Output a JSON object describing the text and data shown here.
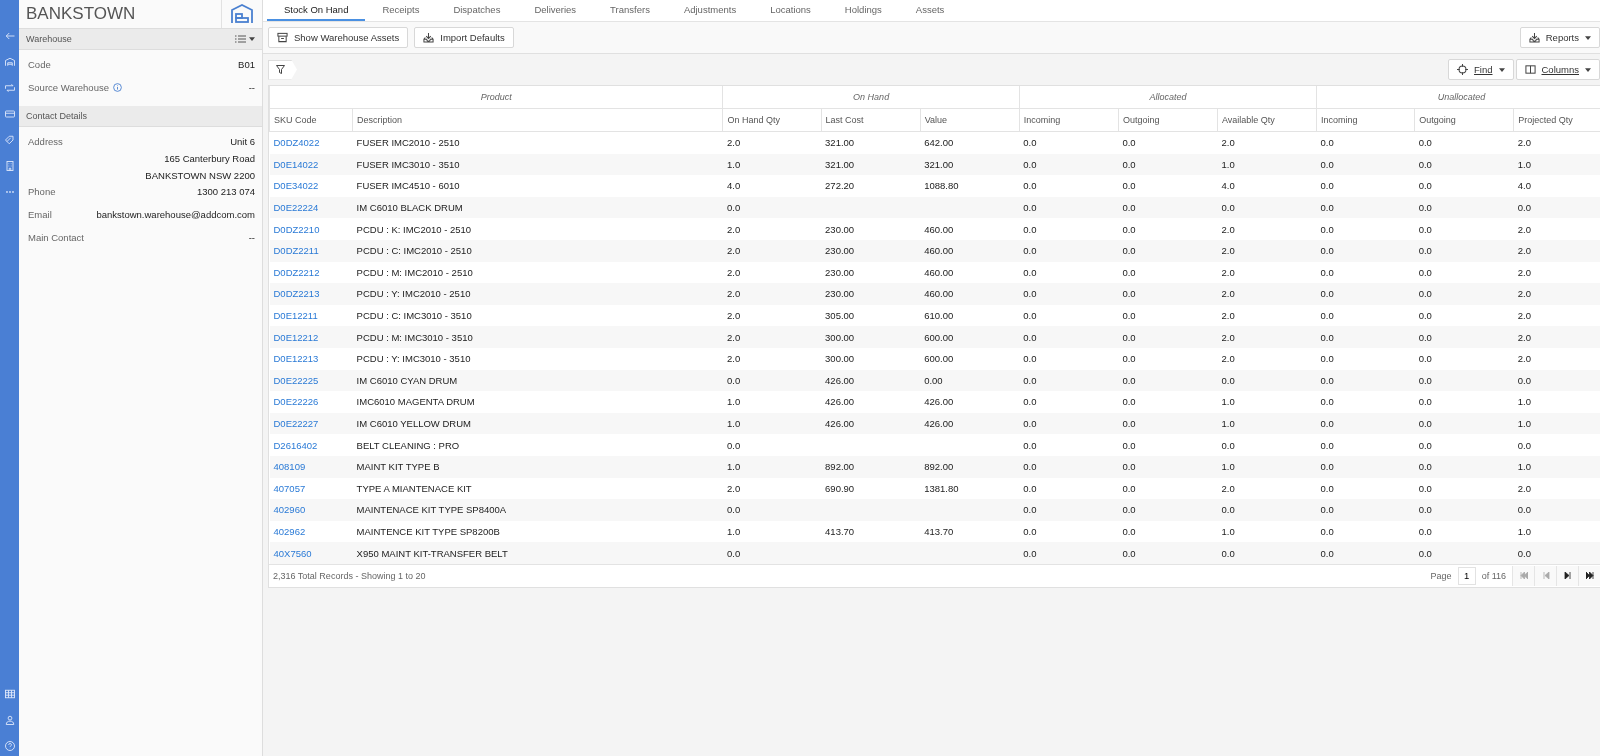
{
  "rail": {
    "items": [
      {
        "kind": "back"
      },
      {
        "kind": "warehouse"
      },
      {
        "kind": "transfer"
      },
      {
        "kind": "card"
      },
      {
        "kind": "tags"
      },
      {
        "kind": "building"
      },
      {
        "kind": "more"
      }
    ],
    "bottom_items": [
      {
        "kind": "grid"
      },
      {
        "kind": "user"
      },
      {
        "kind": "help"
      }
    ]
  },
  "sidebar": {
    "title": "BANKSTOWN",
    "sections": [
      {
        "title": "Warehouse",
        "menu": true,
        "fields": [
          {
            "label": "Code",
            "value": [
              "B01"
            ]
          },
          {
            "label": "Source Warehouse",
            "info": true,
            "value": [
              "--"
            ]
          }
        ]
      },
      {
        "title": "Contact Details",
        "menu": false,
        "fields": [
          {
            "label": "Address",
            "value": [
              "Unit 6",
              "165 Canterbury Road",
              "BANKSTOWN NSW 2200"
            ]
          },
          {
            "label": "Phone",
            "value": [
              "1300 213 074"
            ]
          },
          {
            "label": "Email",
            "value": [
              "bankstown.warehouse@addcom.com"
            ]
          },
          {
            "label": "Main Contact",
            "value": [
              "--"
            ]
          }
        ]
      }
    ]
  },
  "tabs": [
    {
      "label": "Stock On Hand",
      "selected": true
    },
    {
      "label": "Receipts",
      "selected": false
    },
    {
      "label": "Dispatches",
      "selected": false
    },
    {
      "label": "Deliveries",
      "selected": false
    },
    {
      "label": "Transfers",
      "selected": false
    },
    {
      "label": "Adjustments",
      "selected": false
    },
    {
      "label": "Locations",
      "selected": false
    },
    {
      "label": "Holdings",
      "selected": false
    },
    {
      "label": "Assets",
      "selected": false
    }
  ],
  "toolbar": {
    "buttons": [
      {
        "label": "Show Warehouse Assets",
        "kind": "archive"
      },
      {
        "label": "Import Defaults",
        "kind": "import"
      }
    ],
    "reports": "Reports"
  },
  "filter_bar": {
    "find": "Find",
    "columns": "Columns"
  },
  "table": {
    "groups": [
      "Product",
      "On Hand",
      "Allocated",
      "Unallocated"
    ],
    "columns": [
      "SKU Code",
      "Description",
      "On Hand Qty",
      "Last Cost",
      "Value",
      "Incoming",
      "Outgoing",
      "Available Qty",
      "Incoming",
      "Outgoing",
      "Projected Qty"
    ],
    "rows": [
      [
        "D0DZ4022",
        "FUSER IMC2010 - 2510",
        "2.0",
        "321.00",
        "642.00",
        "0.0",
        "0.0",
        "2.0",
        "0.0",
        "0.0",
        "2.0"
      ],
      [
        "D0E14022",
        "FUSER IMC3010 - 3510",
        "1.0",
        "321.00",
        "321.00",
        "0.0",
        "0.0",
        "1.0",
        "0.0",
        "0.0",
        "1.0"
      ],
      [
        "D0E34022",
        "FUSER IMC4510 - 6010",
        "4.0",
        "272.20",
        "1088.80",
        "0.0",
        "0.0",
        "4.0",
        "0.0",
        "0.0",
        "4.0"
      ],
      [
        "D0E22224",
        "IM C6010 BLACK DRUM",
        "0.0",
        null,
        null,
        "0.0",
        "0.0",
        "0.0",
        "0.0",
        "0.0",
        "0.0"
      ],
      [
        "D0DZ2210",
        "PCDU : K: IMC2010 - 2510",
        "2.0",
        "230.00",
        "460.00",
        "0.0",
        "0.0",
        "2.0",
        "0.0",
        "0.0",
        "2.0"
      ],
      [
        "D0DZ2211",
        "PCDU : C: IMC2010 - 2510",
        "2.0",
        "230.00",
        "460.00",
        "0.0",
        "0.0",
        "2.0",
        "0.0",
        "0.0",
        "2.0"
      ],
      [
        "D0DZ2212",
        "PCDU : M: IMC2010 - 2510",
        "2.0",
        "230.00",
        "460.00",
        "0.0",
        "0.0",
        "2.0",
        "0.0",
        "0.0",
        "2.0"
      ],
      [
        "D0DZ2213",
        "PCDU : Y: IMC2010 - 2510",
        "2.0",
        "230.00",
        "460.00",
        "0.0",
        "0.0",
        "2.0",
        "0.0",
        "0.0",
        "2.0"
      ],
      [
        "D0E12211",
        "PCDU : C: IMC3010 - 3510",
        "2.0",
        "305.00",
        "610.00",
        "0.0",
        "0.0",
        "2.0",
        "0.0",
        "0.0",
        "2.0"
      ],
      [
        "D0E12212",
        "PCDU : M: IMC3010 - 3510",
        "2.0",
        "300.00",
        "600.00",
        "0.0",
        "0.0",
        "2.0",
        "0.0",
        "0.0",
        "2.0"
      ],
      [
        "D0E12213",
        "PCDU : Y: IMC3010 - 3510",
        "2.0",
        "300.00",
        "600.00",
        "0.0",
        "0.0",
        "2.0",
        "0.0",
        "0.0",
        "2.0"
      ],
      [
        "D0E22225",
        "IM C6010 CYAN DRUM",
        "0.0",
        "426.00",
        "0.00",
        "0.0",
        "0.0",
        "0.0",
        "0.0",
        "0.0",
        "0.0"
      ],
      [
        "D0E22226",
        "IMC6010 MAGENTA DRUM",
        "1.0",
        "426.00",
        "426.00",
        "0.0",
        "0.0",
        "1.0",
        "0.0",
        "0.0",
        "1.0"
      ],
      [
        "D0E22227",
        "IM C6010 YELLOW DRUM",
        "1.0",
        "426.00",
        "426.00",
        "0.0",
        "0.0",
        "1.0",
        "0.0",
        "0.0",
        "1.0"
      ],
      [
        "D2616402",
        "BELT CLEANING : PRO",
        "0.0",
        null,
        null,
        "0.0",
        "0.0",
        "0.0",
        "0.0",
        "0.0",
        "0.0"
      ],
      [
        "408109",
        "MAINT KIT TYPE B",
        "1.0",
        "892.00",
        "892.00",
        "0.0",
        "0.0",
        "1.0",
        "0.0",
        "0.0",
        "1.0"
      ],
      [
        "407057",
        "TYPE A MIANTENACE KIT",
        "2.0",
        "690.90",
        "1381.80",
        "0.0",
        "0.0",
        "2.0",
        "0.0",
        "0.0",
        "2.0"
      ],
      [
        "402960",
        "MAINTENACE KIT TYPE SP8400A",
        "0.0",
        null,
        null,
        "0.0",
        "0.0",
        "0.0",
        "0.0",
        "0.0",
        "0.0"
      ],
      [
        "402962",
        "MAINTENCE KIT TYPE SP8200B",
        "1.0",
        "413.70",
        "413.70",
        "0.0",
        "0.0",
        "1.0",
        "0.0",
        "0.0",
        "1.0"
      ],
      [
        "40X7560",
        "X950 MAINT KIT-TRANSFER BELT",
        "0.0",
        null,
        null,
        "0.0",
        "0.0",
        "0.0",
        "0.0",
        "0.0",
        "0.0"
      ]
    ]
  },
  "footer": {
    "summary": "2,316 Total Records - Showing 1 to 20",
    "page_label": "Page",
    "page": "1",
    "page_count": "of 116"
  }
}
